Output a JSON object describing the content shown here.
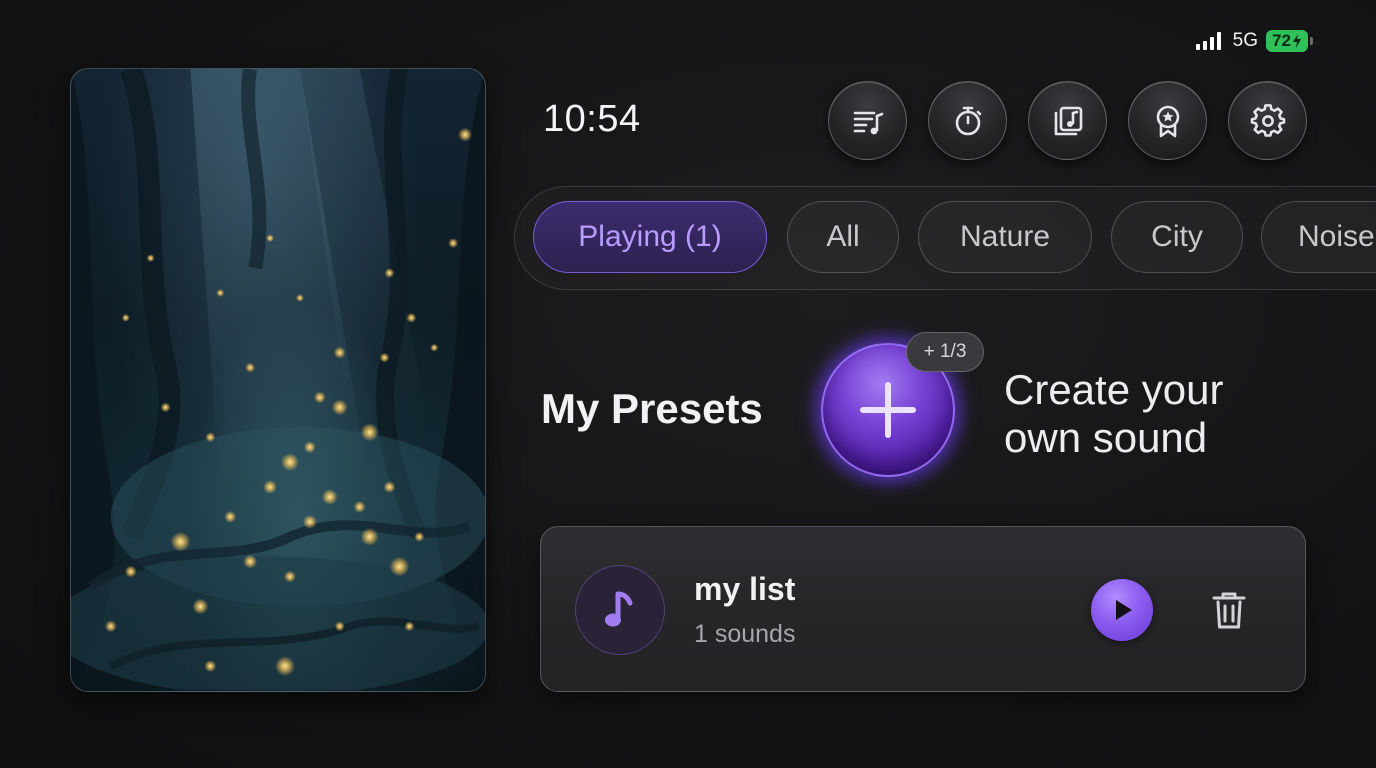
{
  "status_bar": {
    "network": "5G",
    "battery_percent": "72",
    "battery_color": "#30c25a",
    "signal_icon": "signal-bars-icon"
  },
  "scene": {
    "description_icon": "forest-fireflies-artwork"
  },
  "clock": "10:54",
  "toolbar": {
    "buttons": [
      {
        "icon": "playlist-icon"
      },
      {
        "icon": "timer-icon"
      },
      {
        "icon": "music-library-icon"
      },
      {
        "icon": "award-badge-icon"
      },
      {
        "icon": "settings-gear-icon"
      }
    ]
  },
  "filters": {
    "tabs": [
      {
        "label": "Playing (1)",
        "active": true
      },
      {
        "label": "All",
        "active": false
      },
      {
        "label": "Nature",
        "active": false
      },
      {
        "label": "City",
        "active": false
      },
      {
        "label": "Noise",
        "active": false
      }
    ],
    "accent_color": "#7a5bd6"
  },
  "presets": {
    "title": "My Presets",
    "create_badge": "+ 1/3",
    "create_text_line1": "Create your",
    "create_text_line2": "own sound",
    "items": [
      {
        "name": "my list",
        "subtitle": "1 sounds",
        "icon": "music-note-icon"
      }
    ]
  }
}
